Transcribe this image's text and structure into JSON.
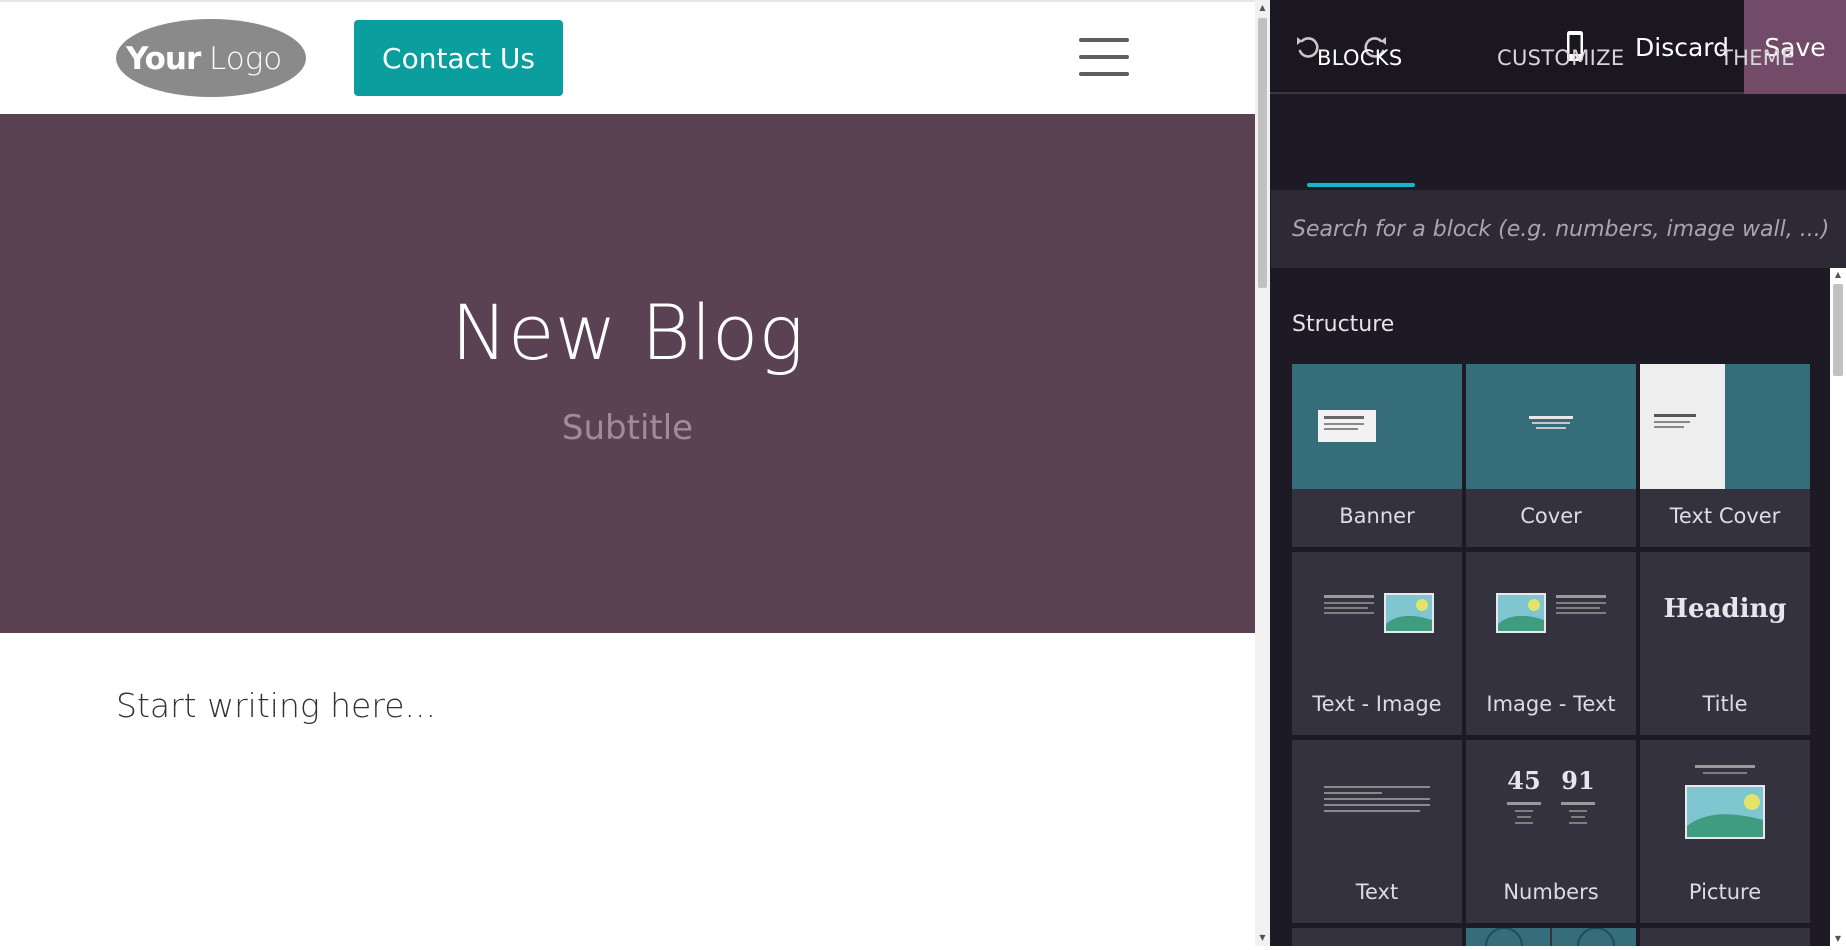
{
  "site": {
    "logo_text": "YourLogo",
    "contact_button": "Contact Us",
    "hero": {
      "title": "New Blog",
      "subtitle": "Subtitle",
      "background": "#5a4253"
    },
    "body_placeholder": "Start writing here..."
  },
  "editor": {
    "toolbar": {
      "undo_icon": "undo-icon",
      "redo_icon": "redo-icon",
      "mobile_icon": "mobile-phone-icon",
      "discard_label": "Discard",
      "save_label": "Save"
    },
    "tabs": [
      {
        "label": "BLOCKS",
        "active": true
      },
      {
        "label": "CUSTOMIZE",
        "active": false
      },
      {
        "label": "THEME",
        "active": false
      }
    ],
    "search": {
      "placeholder": "Search for a block (e.g. numbers, image wall, ...)",
      "value": ""
    },
    "section": "Structure",
    "blocks": [
      {
        "label": "Banner"
      },
      {
        "label": "Cover"
      },
      {
        "label": "Text Cover"
      },
      {
        "label": "Text - Image"
      },
      {
        "label": "Image - Text"
      },
      {
        "label": "Title",
        "thumb_text": "Heading"
      },
      {
        "label": "Text"
      },
      {
        "label": "Numbers",
        "thumb_numbers": [
          "45",
          "91"
        ]
      },
      {
        "label": "Picture"
      }
    ]
  },
  "colors": {
    "accent_teal": "#0a9e9e",
    "save_purple": "#714b67",
    "tab_underline": "#18b7c8",
    "panel_bg": "#1d1a25"
  }
}
